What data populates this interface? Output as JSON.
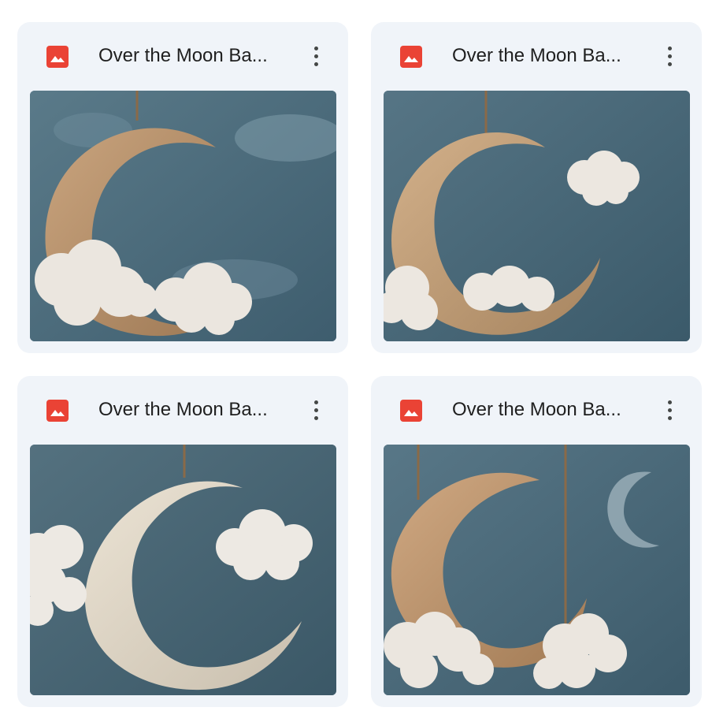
{
  "files": [
    {
      "name": "Over the Moon Ba...",
      "icon": "image-icon",
      "icon_color": "#ea4335"
    },
    {
      "name": "Over the Moon Ba...",
      "icon": "image-icon",
      "icon_color": "#ea4335"
    },
    {
      "name": "Over the Moon Ba...",
      "icon": "image-icon",
      "icon_color": "#ea4335"
    },
    {
      "name": "Over the Moon Ba...",
      "icon": "image-icon",
      "icon_color": "#ea4335"
    }
  ],
  "more_icon": "more-vert-icon",
  "card_background": "#f0f4f9"
}
